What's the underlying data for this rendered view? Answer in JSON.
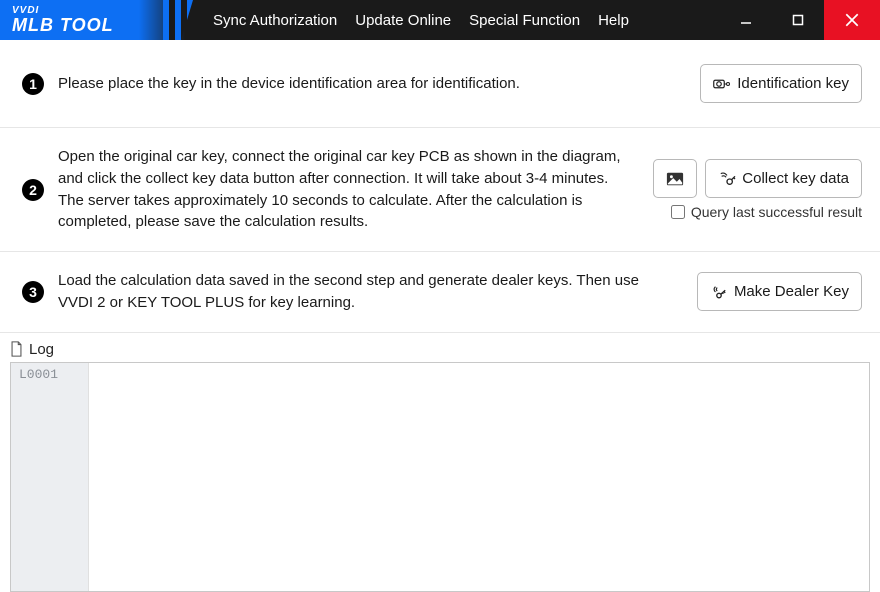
{
  "app": {
    "logo_top": "VVDI",
    "logo_bottom": "MLB TOOL"
  },
  "menu": {
    "sync": "Sync Authorization",
    "update": "Update Online",
    "special": "Special Function",
    "help": "Help"
  },
  "steps": {
    "s1": {
      "num": "1",
      "text": "Please place the key in the device identification area for identification.",
      "btn": "Identification key"
    },
    "s2": {
      "num": "2",
      "text": "Open the original car key, connect the original car key PCB as shown in the diagram, and click the collect key data button after connection. It will take about 3-4 minutes. The server takes approximately 10 seconds to calculate. After the calculation is completed, please save the calculation results.",
      "btn": "Collect key data",
      "checkbox": "Query last successful result"
    },
    "s3": {
      "num": "3",
      "text": "Load the calculation data saved in the second step and generate dealer keys. Then use VVDI 2 or KEY TOOL PLUS for key learning.",
      "btn": "Make Dealer Key"
    }
  },
  "log": {
    "title": "Log",
    "line1": "L0001"
  }
}
